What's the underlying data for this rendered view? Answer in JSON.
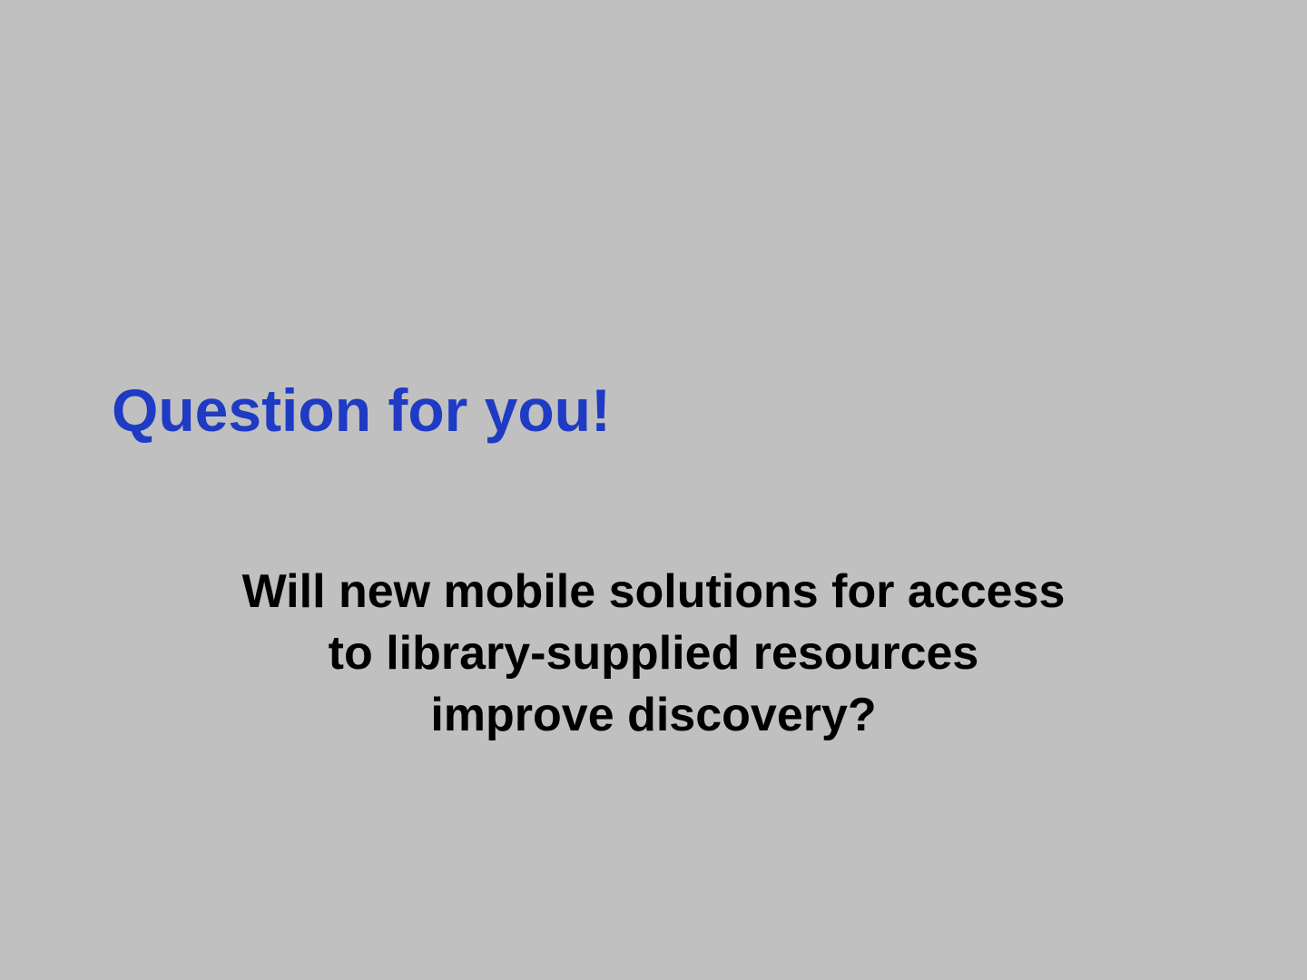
{
  "slide": {
    "title": "Question for you!",
    "question_lines": [
      "Will new mobile solutions for access",
      "to library-supplied resources",
      "improve discovery?"
    ]
  },
  "colors": {
    "background": "#c0c0c0",
    "title": "#1f3bc4",
    "body_text": "#000000"
  }
}
